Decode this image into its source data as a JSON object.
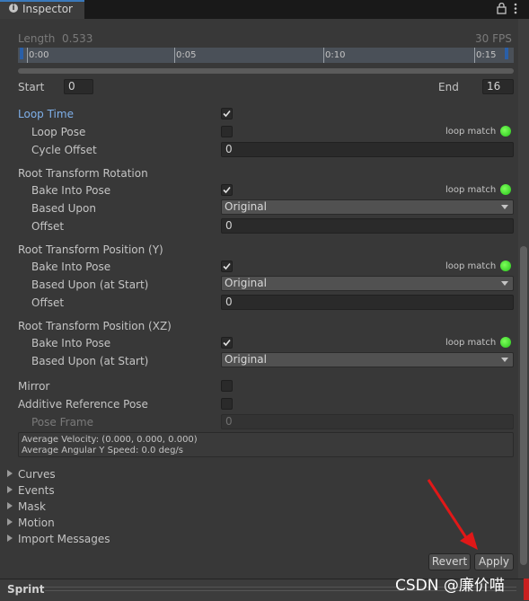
{
  "window": {
    "tab_title": "Inspector",
    "info_icon": "info-icon",
    "lock_icon": "lock-icon",
    "menu_icon": "kebab-menu-icon"
  },
  "clip": {
    "length_label": "Length",
    "length_value": "0.533",
    "fps": "30 FPS",
    "timeline_ticks": [
      "0:00",
      "0:05",
      "0:10",
      "0:15"
    ],
    "start_label": "Start",
    "start_value": "0",
    "end_label": "End",
    "end_value": "16"
  },
  "loop": {
    "loop_time_label": "Loop Time",
    "loop_time_checked": true,
    "loop_pose_label": "Loop Pose",
    "loop_pose_checked": false,
    "loop_match": "loop match",
    "cycle_offset_label": "Cycle Offset",
    "cycle_offset_value": "0"
  },
  "rotation": {
    "header": "Root Transform Rotation",
    "bake_label": "Bake Into Pose",
    "bake_checked": true,
    "loop_match": "loop match",
    "based_upon_label": "Based Upon",
    "based_upon_value": "Original",
    "offset_label": "Offset",
    "offset_value": "0"
  },
  "position_y": {
    "header": "Root Transform Position (Y)",
    "bake_label": "Bake Into Pose",
    "bake_checked": true,
    "loop_match": "loop match",
    "based_upon_label": "Based Upon (at Start)",
    "based_upon_value": "Original",
    "offset_label": "Offset",
    "offset_value": "0"
  },
  "position_xz": {
    "header": "Root Transform Position (XZ)",
    "bake_label": "Bake Into Pose",
    "bake_checked": true,
    "loop_match": "loop match",
    "based_upon_label": "Based Upon (at Start)",
    "based_upon_value": "Original"
  },
  "misc": {
    "mirror_label": "Mirror",
    "additive_label": "Additive Reference Pose",
    "pose_frame_label": "Pose Frame",
    "pose_frame_value": "0",
    "avg_velocity": "Average Velocity: (0.000, 0.000, 0.000)",
    "avg_angular": "Average Angular Y Speed: 0.0 deg/s"
  },
  "foldouts": [
    "Curves",
    "Events",
    "Mask",
    "Motion",
    "Import Messages"
  ],
  "buttons": {
    "revert": "Revert",
    "apply": "Apply"
  },
  "bottom": {
    "sprint_label": "Sprint"
  },
  "watermark": "CSDN @廉价喵",
  "colors": {
    "accent_blue": "#7fb0ea",
    "loop_match_green": "#3ee01f",
    "arrow_red": "#e01818"
  }
}
